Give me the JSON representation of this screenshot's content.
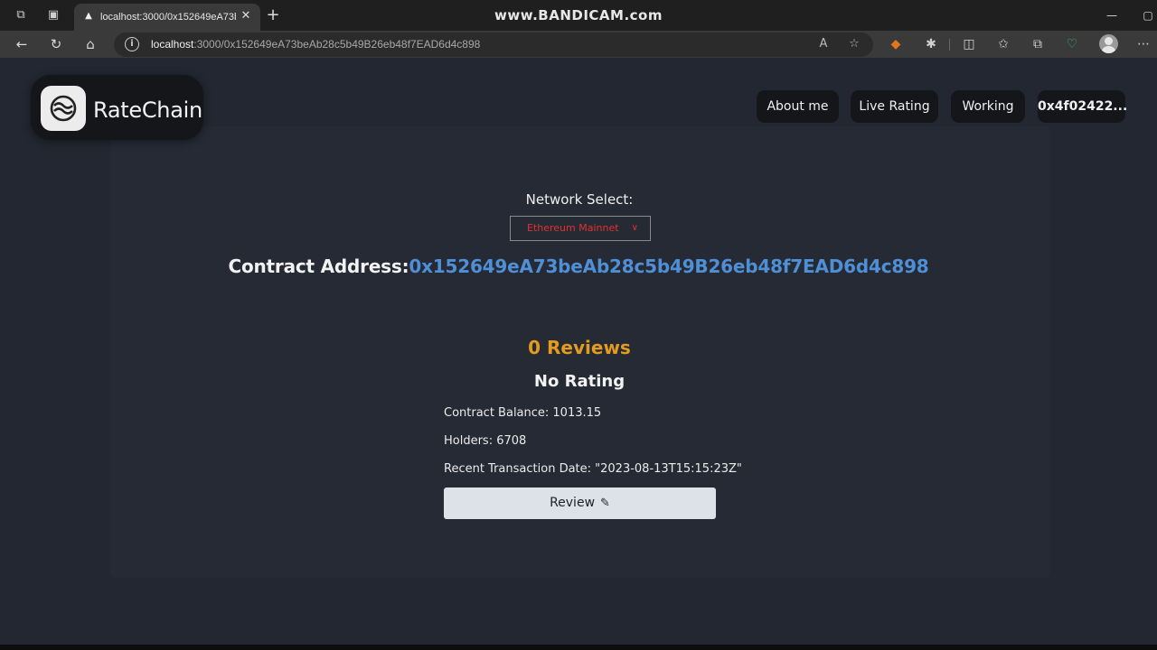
{
  "browser": {
    "tab_title": "localhost:3000/0x152649eA73be",
    "watermark": "www.BANDICAM.com",
    "url_host": "localhost",
    "url_rest": ":3000/0x152649eA73beAb28c5b49B26eb48f7EAD6d4c898",
    "icons": {
      "workspaces": "workspaces-icon",
      "tab_actions": "tab-actions-icon",
      "favicon": "triangle-favicon-icon",
      "close": "close-icon",
      "new_tab": "plus-icon",
      "back": "back-arrow-icon",
      "refresh": "refresh-icon",
      "home": "home-icon",
      "info": "info-icon",
      "read_aloud": "read-aloud-icon",
      "favorite": "star-icon",
      "metamask": "fox-extension-icon",
      "extensions": "puzzle-icon",
      "split": "split-screen-icon",
      "favorites": "favorites-icon",
      "collections": "collections-icon",
      "health": "heart-pulse-icon",
      "profile": "profile-icon",
      "menu": "more-icon"
    }
  },
  "app": {
    "logo_text": "RateChain",
    "nav": [
      {
        "label": "About me"
      },
      {
        "label": "Live Rating"
      },
      {
        "label": "Working"
      }
    ],
    "wallet": "0x4f02422...",
    "network_label": "Network Select:",
    "network_selected": "Ethereum Mainnet",
    "contract_label": "Contract Address:",
    "contract_address": "0x152649eA73beAb28c5b49B26eb48f7EAD6d4c898",
    "reviews": "0 Reviews",
    "rating": "No Rating",
    "balance": "Contract Balance: 1013.15",
    "holders": "Holders: 6708",
    "recent_tx": "Recent Transaction Date: \"2023-08-13T15:15:23Z\"",
    "review_button": "Review"
  },
  "colors": {
    "background": "#232731",
    "accent_address": "#4f8fd6",
    "reviews_orange": "#e39c1e",
    "network_red": "#e0332e"
  }
}
